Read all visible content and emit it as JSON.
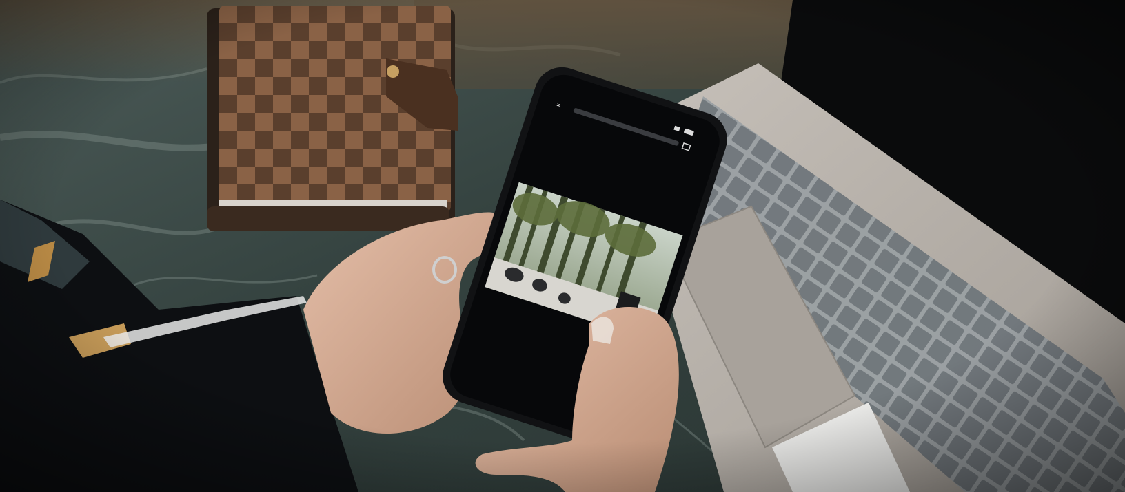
{
  "scene": {
    "colors": {
      "marble": "#3a4a47",
      "marble_light": "#8f9d99",
      "planner_dark": "#4a3426",
      "planner_light": "#8a6246",
      "laptop_body": "#b9b3ac",
      "laptop_keys": "#747b80",
      "sleeve": "#0d0f12",
      "skin": "#d9b199",
      "phone_body": "#111214",
      "phone_screen": "#07080a"
    }
  },
  "phone": {
    "status_time": "",
    "address_text": ""
  }
}
